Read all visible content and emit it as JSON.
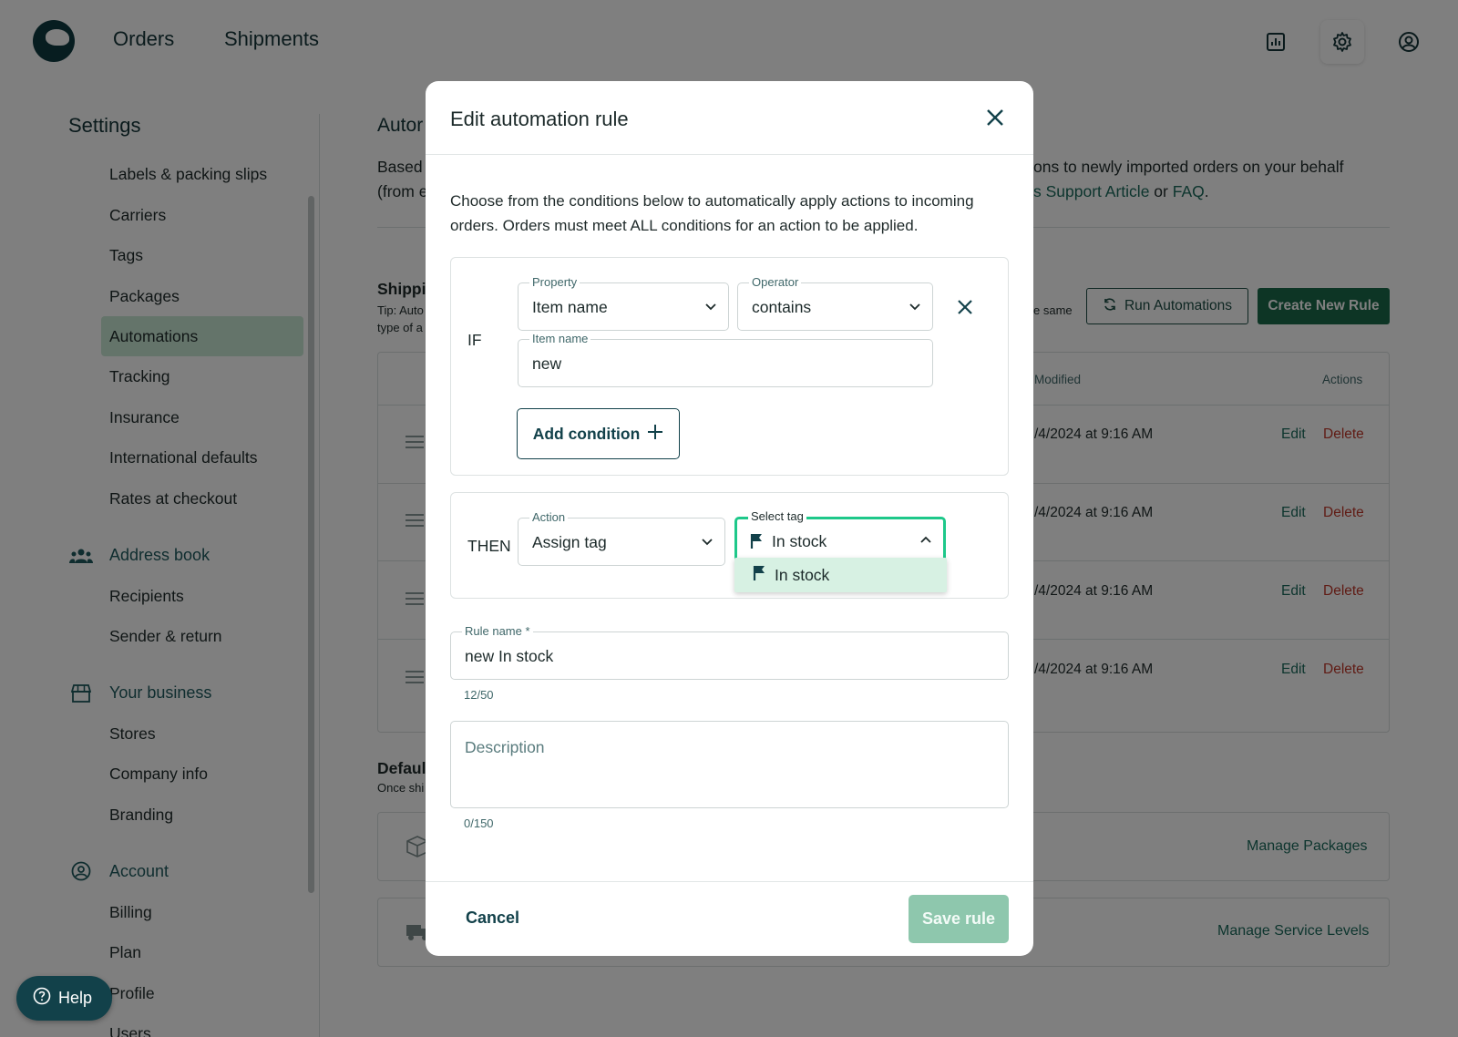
{
  "topbar": {
    "nav": [
      "Orders",
      "Shipments"
    ],
    "icons": [
      "reports-icon",
      "gear-icon",
      "user-account-icon"
    ]
  },
  "sidebar": {
    "title": "Settings",
    "items": [
      "Labels & packing slips",
      "Carriers",
      "Tags",
      "Packages",
      "Automations",
      "Tracking",
      "Insurance",
      "International defaults",
      "Rates at checkout"
    ],
    "active_item": "Automations",
    "address_book": {
      "label": "Address book",
      "items": [
        "Recipients",
        "Sender & return"
      ]
    },
    "your_business": {
      "label": "Your business",
      "items": [
        "Stores",
        "Company info",
        "Branding"
      ]
    },
    "account": {
      "label": "Account",
      "items": [
        "Billing",
        "Plan",
        "Profile",
        "Users"
      ]
    }
  },
  "main": {
    "title_partial": "Autor",
    "desc_left_1": "Based",
    "desc_left_2": "(from e",
    "desc_right_1": "ons to newly imported orders on your behalf",
    "desc_right_2_link": "s Support Article",
    "desc_right_2_or": "or",
    "desc_right_2_faq": "FAQ",
    "shipping_partial": "Shippi",
    "tip_1": "Tip: Auto",
    "tip_2": "type of a",
    "same_partial": "e same",
    "run_automations": "Run Automations",
    "create_rule": "Create New Rule",
    "col_modified": "Modified",
    "col_actions": "Actions",
    "rows": [
      {
        "date": "/4/2024 at 9:16 AM",
        "edit": "Edit",
        "delete": "Delete"
      },
      {
        "date": "/4/2024 at 9:16 AM",
        "edit": "Edit",
        "delete": "Delete"
      },
      {
        "date": "/4/2024 at 9:16 AM",
        "edit": "Edit",
        "delete": "Delete"
      },
      {
        "date": "/4/2024 at 9:16 AM",
        "edit": "Edit",
        "delete": "Delete"
      }
    ],
    "defaults_partial": "Defaul",
    "defaults_sub": "Once shi",
    "manage_packages": "Manage Packages",
    "manage_service_levels": "Manage Service Levels"
  },
  "help": {
    "label": "Help"
  },
  "modal": {
    "title": "Edit automation rule",
    "intro": "Choose from the conditions below to automatically apply actions to incoming orders. Orders must meet ALL conditions for an action to be applied.",
    "if_label": "IF",
    "property": {
      "label": "Property",
      "value": "Item name"
    },
    "operator": {
      "label": "Operator",
      "value": "contains"
    },
    "item_name": {
      "label": "Item name",
      "value": "new"
    },
    "add_condition": "Add condition",
    "then_label": "THEN",
    "action": {
      "label": "Action",
      "value": "Assign tag"
    },
    "select_tag": {
      "label": "Select tag",
      "value": "In stock"
    },
    "dropdown_option": "In stock",
    "rule_name": {
      "label": "Rule name",
      "required_mark": "*",
      "value": "new In stock",
      "counter": "12/50"
    },
    "description": {
      "placeholder": "Description",
      "counter": "0/150"
    },
    "cancel": "Cancel",
    "save": "Save rule"
  }
}
